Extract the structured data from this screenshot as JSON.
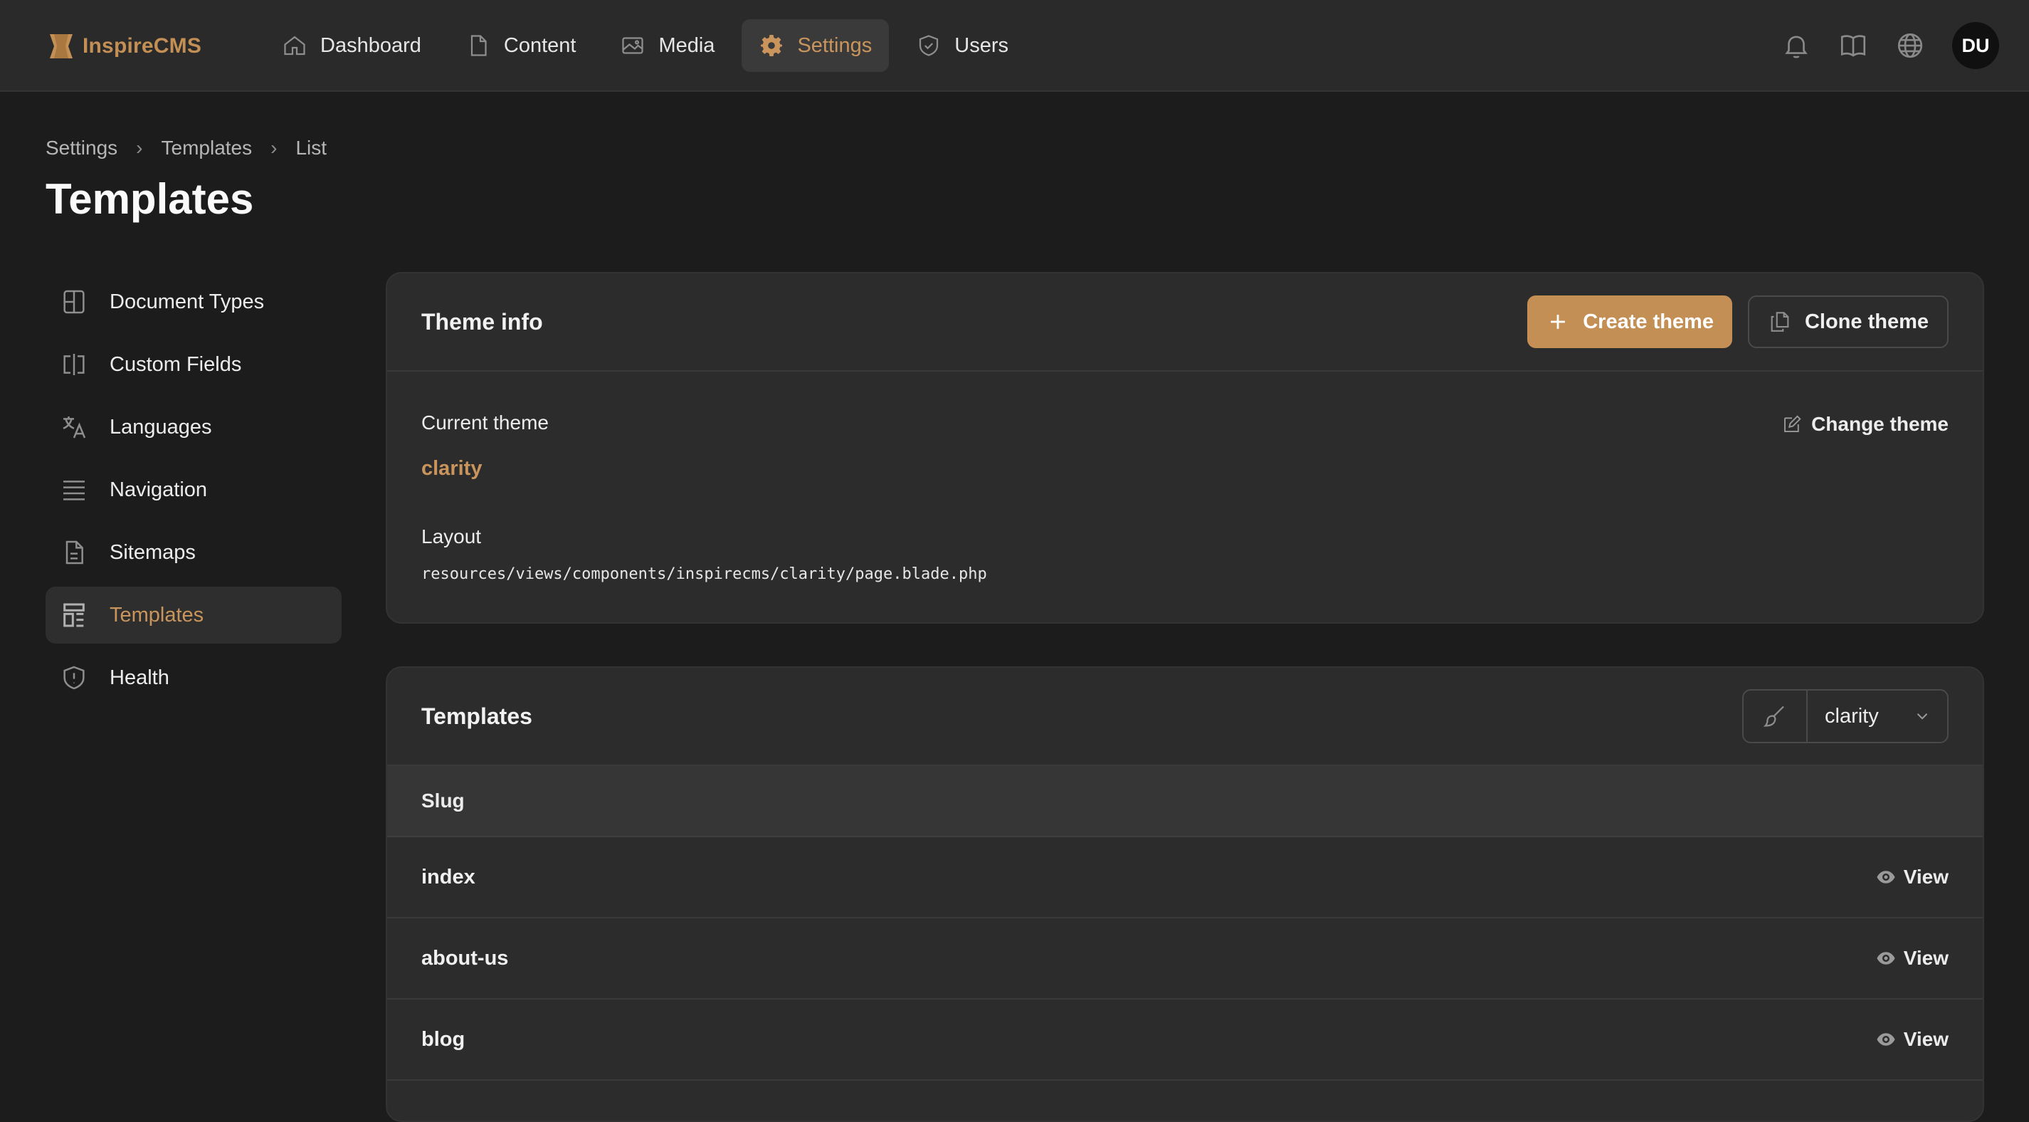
{
  "brand": {
    "name": "InspireCMS",
    "accent": "#c38f55"
  },
  "nav": [
    {
      "label": "Dashboard",
      "icon": "home-icon"
    },
    {
      "label": "Content",
      "icon": "document-icon"
    },
    {
      "label": "Media",
      "icon": "image-icon"
    },
    {
      "label": "Settings",
      "icon": "gear-icon",
      "active": true
    },
    {
      "label": "Users",
      "icon": "shield-check-icon"
    }
  ],
  "topbar": {
    "avatar": "DU"
  },
  "breadcrumb": [
    "Settings",
    "Templates",
    "List"
  ],
  "page": {
    "title": "Templates"
  },
  "sidebar": [
    {
      "label": "Document Types",
      "icon": "layout-icon"
    },
    {
      "label": "Custom Fields",
      "icon": "columns-icon"
    },
    {
      "label": "Languages",
      "icon": "translate-icon"
    },
    {
      "label": "Navigation",
      "icon": "menu-lines-icon"
    },
    {
      "label": "Sitemaps",
      "icon": "file-icon"
    },
    {
      "label": "Templates",
      "icon": "template-icon",
      "active": true
    },
    {
      "label": "Health",
      "icon": "shield-alert-icon"
    }
  ],
  "theme_info": {
    "title": "Theme info",
    "create_label": "Create theme",
    "clone_label": "Clone theme",
    "current_label": "Current theme",
    "current_value": "clarity",
    "change_label": "Change theme",
    "layout_label": "Layout",
    "layout_value": "resources/views/components/inspirecms/clarity/page.blade.php"
  },
  "templates": {
    "title": "Templates",
    "theme_select": "clarity",
    "column": "Slug",
    "view_label": "View",
    "rows": [
      "index",
      "about-us",
      "blog"
    ]
  }
}
